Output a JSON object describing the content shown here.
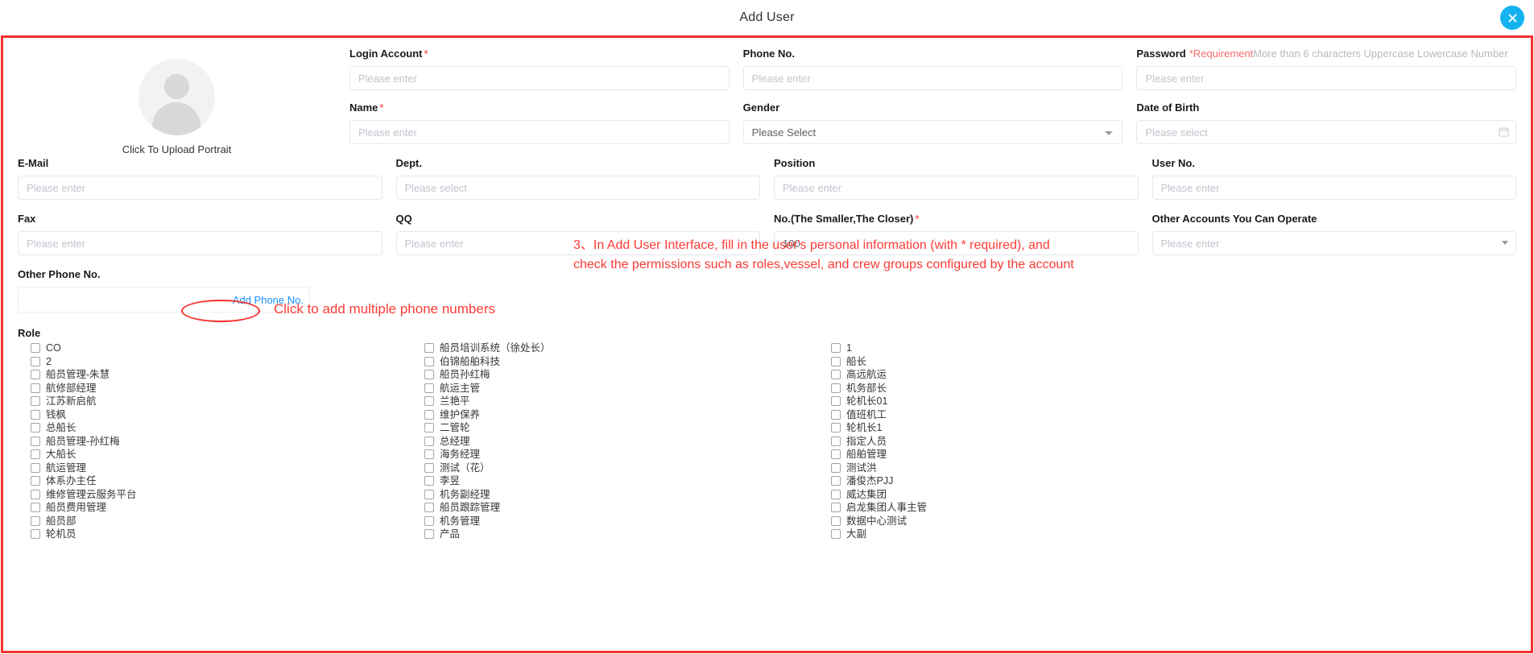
{
  "dialog": {
    "title": "Add User",
    "close_icon": "close-icon"
  },
  "avatar": {
    "caption": "Click To Upload Portrait"
  },
  "fields": {
    "login_account": {
      "label": "Login Account",
      "required": "*",
      "placeholder": "Please enter",
      "value": ""
    },
    "phone_no": {
      "label": "Phone No.",
      "placeholder": "Please enter",
      "value": ""
    },
    "password": {
      "label": "Password",
      "req_mark": "*Requirement",
      "hint": "More than 6 characters  Uppercase Lowercase Number",
      "placeholder": "Please enter",
      "value": ""
    },
    "name": {
      "label": "Name",
      "required": "*",
      "placeholder": "Please enter",
      "value": ""
    },
    "gender": {
      "label": "Gender",
      "selected": "Please Select",
      "options": [
        "Please Select"
      ]
    },
    "date_of_birth": {
      "label": "Date of Birth",
      "placeholder": "Please select",
      "value": ""
    },
    "email": {
      "label": "E-Mail",
      "placeholder": "Please enter",
      "value": ""
    },
    "dept": {
      "label": "Dept.",
      "placeholder": "Please select",
      "value": ""
    },
    "position": {
      "label": "Position",
      "placeholder": "Please enter",
      "value": ""
    },
    "user_no": {
      "label": "User No.",
      "placeholder": "Please enter",
      "value": ""
    },
    "fax": {
      "label": "Fax",
      "placeholder": "Please enter",
      "value": ""
    },
    "qq": {
      "label": "QQ",
      "placeholder": "Please enter",
      "value": ""
    },
    "order_no": {
      "label": "No.(The Smaller,The Closer)",
      "required": "*",
      "placeholder": "Please enter",
      "value": "100"
    },
    "other_accounts": {
      "label": "Other Accounts You Can Operate",
      "placeholder": "Please enter",
      "value": ""
    },
    "other_phone_no": {
      "label": "Other Phone No.",
      "add_label": "Add Phone No."
    }
  },
  "annotations": {
    "inline_note": "Click to add multiple phone numbers",
    "paragraph_line1": "3、In Add User Interface, fill in the user's personal information (with * required), and",
    "paragraph_line2": "check the permissions such as roles,vessel, and crew groups configured by the account",
    "color": "#fb3b36"
  },
  "role": {
    "title": "Role",
    "column1": [
      "CO",
      "2",
      "船员管理-朱慧",
      "航修部经理",
      "江苏新启航",
      "钱枫",
      "总船长",
      "船员管理-孙红梅",
      "大船长",
      "航运管理",
      "体系办主任",
      "维修管理云服务平台",
      "船员费用管理",
      "船员部",
      "轮机员"
    ],
    "column2": [
      "船员培训系统（徐处长）",
      "伯锦船舶科技",
      "船员孙红梅",
      "航运主管",
      "兰艳平",
      "维护保养",
      "二管轮",
      "总经理",
      "海务经理",
      "测试（花）",
      "李昱",
      "机务副经理",
      "船员跟踪管理",
      "机务管理",
      "产品"
    ],
    "column3": [
      "1",
      "船长",
      "高远航运",
      "机务部长",
      "轮机长01",
      "值班机工",
      "轮机长1",
      "指定人员",
      "船舶管理",
      "测试洪",
      "潘俊杰PJJ",
      "威达集团",
      "启龙集团人事主管",
      "数据中心测试",
      "大副"
    ]
  },
  "colors": {
    "accent_blue": "#1890ff",
    "close_button": "#14b3f0",
    "annotation_red": "#f5322d",
    "required_red": "#f56c6c"
  }
}
